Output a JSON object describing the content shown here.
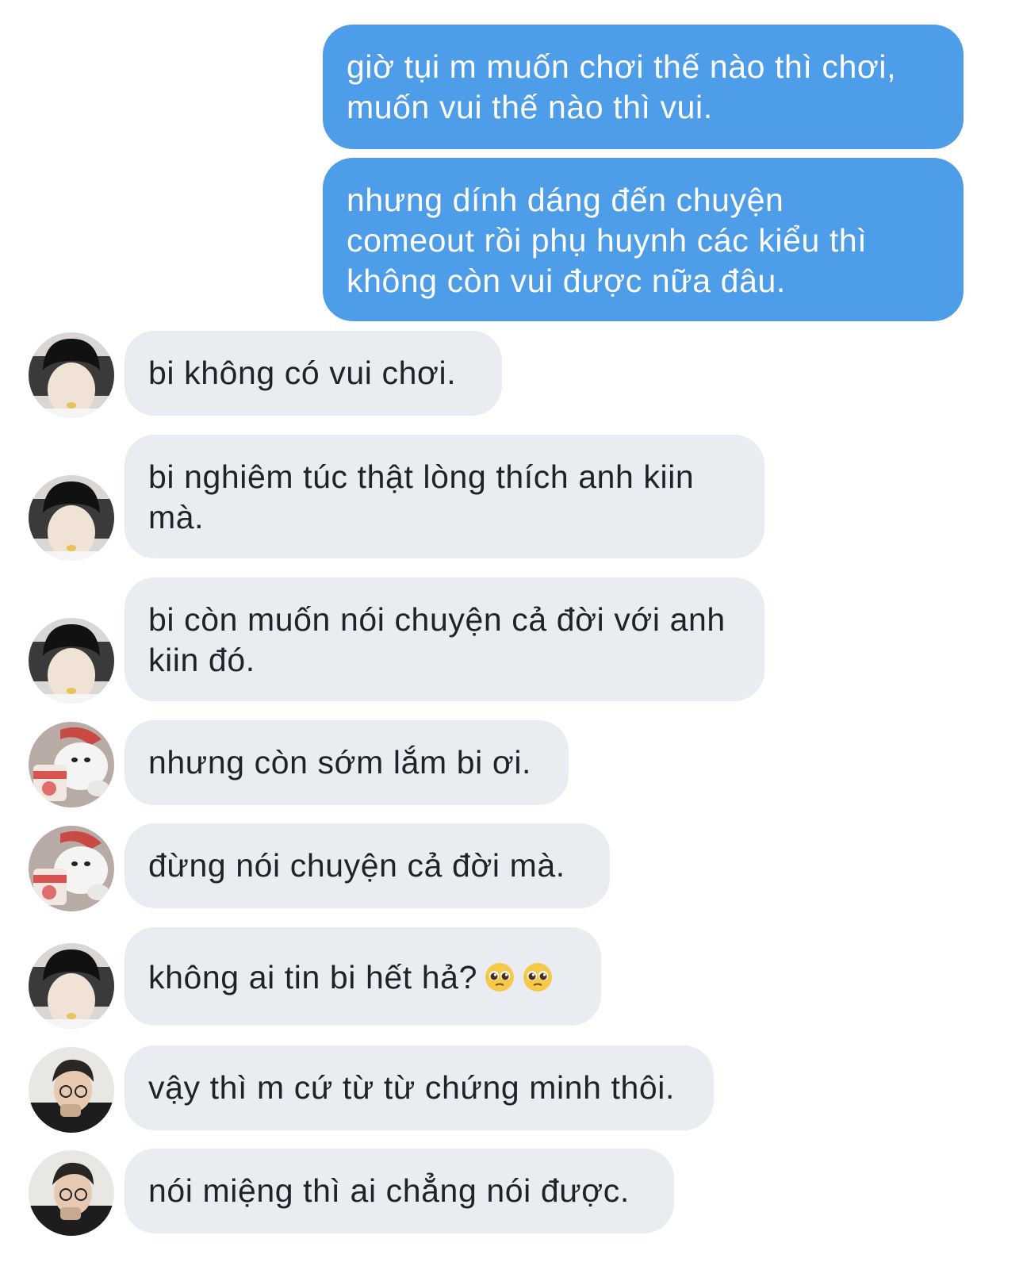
{
  "colors": {
    "outgoing_bubble": "#4e9de9",
    "incoming_bubble": "#e9ecf1",
    "outgoing_text": "#ffffff",
    "incoming_text": "#1f2328"
  },
  "messages": [
    {
      "direction": "outgoing",
      "lines": [
        "giờ tụi m muốn chơi thế nào thì chơi,",
        "muốn vui thế nào thì vui."
      ]
    },
    {
      "direction": "outgoing",
      "lines": [
        "nhưng dính dáng đến chuyện",
        "comeout rồi phụ huynh các kiểu thì",
        "không còn vui được nữa đâu."
      ]
    },
    {
      "direction": "incoming",
      "sender_avatar": "avatar-boy-eating",
      "lines": [
        "bi không có vui chơi."
      ]
    },
    {
      "direction": "incoming",
      "sender_avatar": "avatar-boy-eating",
      "lines": [
        "bi nghiêm túc thật lòng thích anh kiin",
        "mà."
      ]
    },
    {
      "direction": "incoming",
      "sender_avatar": "avatar-boy-eating",
      "lines": [
        "bi còn muốn nói chuyện cả đời với anh",
        "kiin đó."
      ]
    },
    {
      "direction": "incoming",
      "sender_avatar": "avatar-bear-icecream",
      "lines": [
        "nhưng còn sớm lắm bi ơi."
      ]
    },
    {
      "direction": "incoming",
      "sender_avatar": "avatar-bear-icecream",
      "lines": [
        "đừng nói chuyện cả đời mà."
      ]
    },
    {
      "direction": "incoming",
      "sender_avatar": "avatar-boy-eating",
      "lines": [
        "không ai tin bi hết hả?"
      ],
      "emoji": [
        "pleading-face-icon",
        "pleading-face-icon"
      ]
    },
    {
      "direction": "incoming",
      "sender_avatar": "avatar-man-glasses",
      "lines": [
        "vậy thì m cứ từ từ chứng minh thôi."
      ]
    },
    {
      "direction": "incoming",
      "sender_avatar": "avatar-man-glasses",
      "lines": [
        "nói miệng thì ai chẳng nói được."
      ]
    }
  ]
}
